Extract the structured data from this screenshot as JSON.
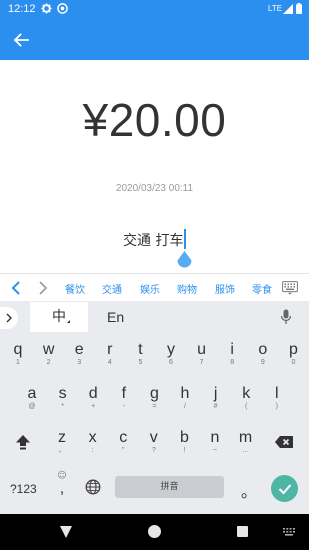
{
  "status_bar": {
    "time": "12:12",
    "network": "LTE"
  },
  "header": {
    "back_icon": "arrow-left-icon"
  },
  "record": {
    "amount": "¥20.00",
    "datetime": "2020/03/23 00:11",
    "note": "交通 打车"
  },
  "categories": {
    "items": [
      "餐饮",
      "交通",
      "娱乐",
      "购物",
      "服饰",
      "零食"
    ]
  },
  "keyboard": {
    "tab_chinese": "中",
    "tab_english": "En",
    "row1": [
      {
        "k": "q",
        "s": "1"
      },
      {
        "k": "w",
        "s": "2"
      },
      {
        "k": "e",
        "s": "3"
      },
      {
        "k": "r",
        "s": "4"
      },
      {
        "k": "t",
        "s": "5"
      },
      {
        "k": "y",
        "s": "6"
      },
      {
        "k": "u",
        "s": "7"
      },
      {
        "k": "i",
        "s": "8"
      },
      {
        "k": "o",
        "s": "9"
      },
      {
        "k": "p",
        "s": "0"
      }
    ],
    "row2": [
      {
        "k": "a",
        "s": "@"
      },
      {
        "k": "s",
        "s": "*"
      },
      {
        "k": "d",
        "s": "+"
      },
      {
        "k": "f",
        "s": "-"
      },
      {
        "k": "g",
        "s": "="
      },
      {
        "k": "h",
        "s": "/"
      },
      {
        "k": "j",
        "s": "#"
      },
      {
        "k": "k",
        "s": "("
      },
      {
        "k": "l",
        "s": ")"
      }
    ],
    "row3": [
      {
        "k": "z",
        "s": "、"
      },
      {
        "k": "x",
        "s": ":"
      },
      {
        "k": "c",
        "s": "\""
      },
      {
        "k": "v",
        "s": "?"
      },
      {
        "k": "b",
        "s": "!"
      },
      {
        "k": "n",
        "s": "~"
      },
      {
        "k": "m",
        "s": "…"
      }
    ],
    "numbers_key": "?123",
    "comma_key": ",",
    "comma_sub": "☺",
    "space_label": "拼音",
    "period_key": "。"
  },
  "colors": {
    "primary": "#2b8ff0",
    "enter": "#4fb6a5"
  }
}
